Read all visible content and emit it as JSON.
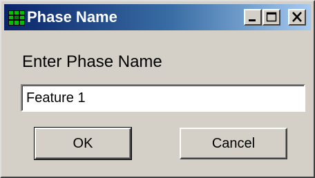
{
  "window": {
    "title": "Phase Name",
    "icon": "green-grid-app-icon",
    "controls": {
      "minimize_icon": "minimize-icon",
      "maximize_icon": "maximize-icon",
      "close_icon": "close-icon"
    }
  },
  "dialog": {
    "prompt": "Enter Phase Name",
    "input_value": "Feature 1",
    "ok_label": "OK",
    "cancel_label": "Cancel"
  },
  "colors": {
    "title_bar_start": "#0a246a",
    "title_bar_end": "#a6caf0",
    "dialog_face": "#d4d0c8",
    "icon_green": "#00c000"
  }
}
